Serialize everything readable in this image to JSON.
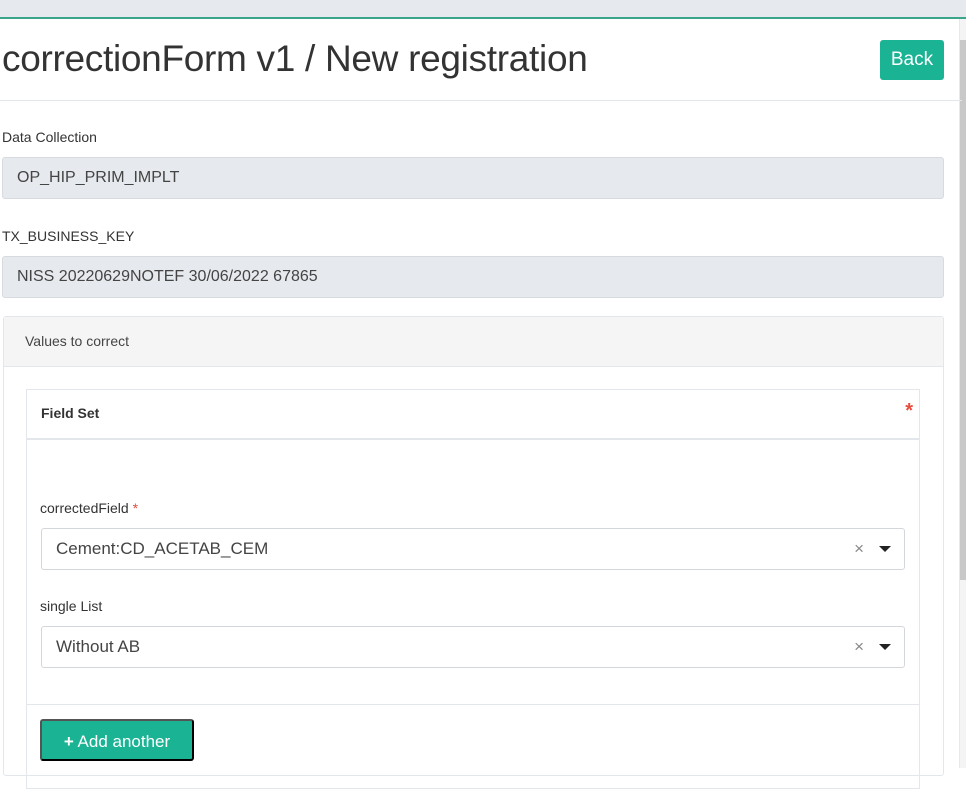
{
  "header": {
    "title": "correctionForm v1 / New registration",
    "back_label": "Back"
  },
  "fields": {
    "data_collection": {
      "label": "Data Collection",
      "value": "OP_HIP_PRIM_IMPLT"
    },
    "tx_business_key": {
      "label": "TX_BUSINESS_KEY",
      "value": "NISS 20220629NOTEF 30/06/2022 67865"
    }
  },
  "panel": {
    "title": "Values to correct",
    "fieldset": {
      "title": "Field Set",
      "required_mark": "*",
      "corrected_field": {
        "label": "correctedField",
        "required_mark": "*",
        "value": "Cement:CD_ACETAB_CEM",
        "clear": "×"
      },
      "single_list": {
        "label": "single List",
        "value": "Without AB",
        "clear": "×"
      },
      "add_label": "Add another",
      "add_icon": "+"
    }
  },
  "colors": {
    "accent": "#1ab394",
    "required": "#e74c3c"
  }
}
